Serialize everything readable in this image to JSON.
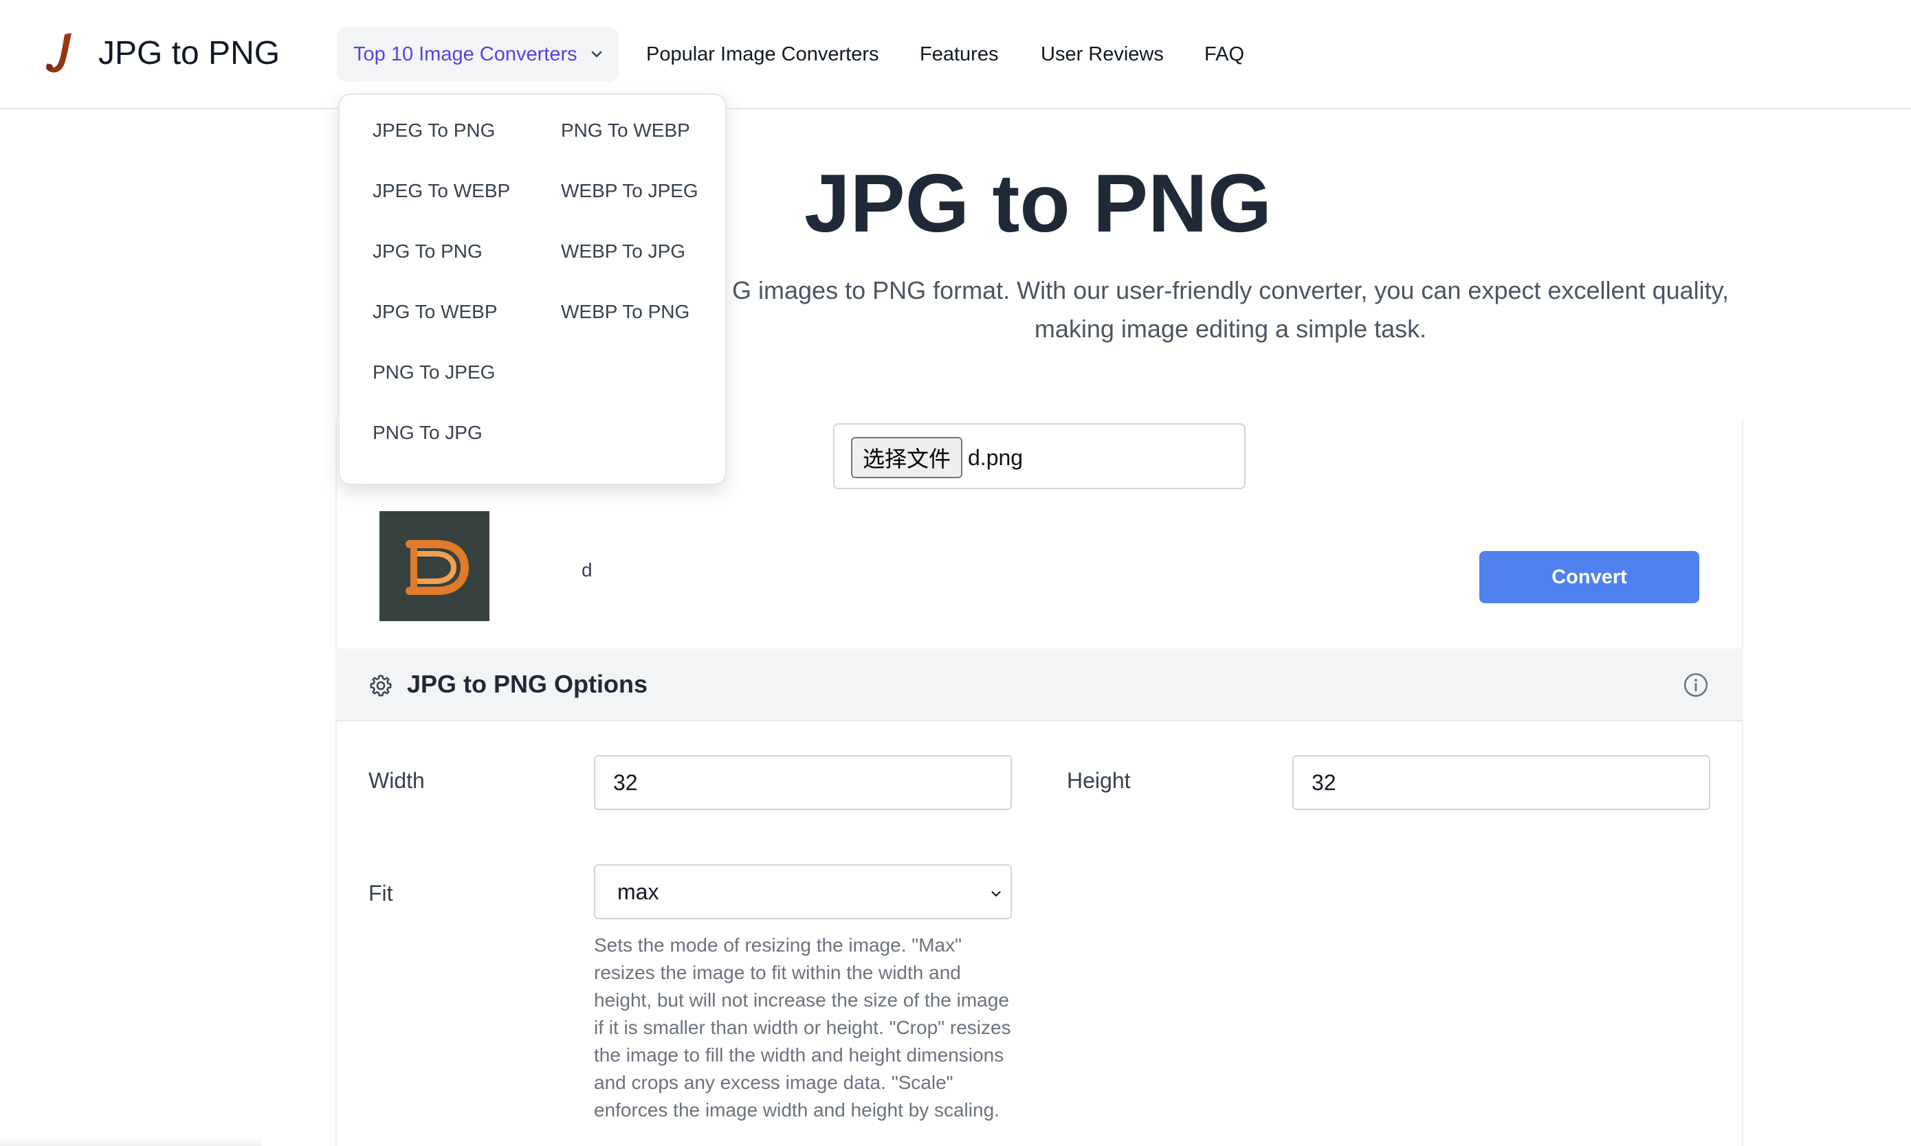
{
  "header": {
    "brand": "JPG to PNG",
    "logo_icon": "j-letter-logo-icon",
    "nav": {
      "dropdown_label": "Top 10 Image Converters",
      "items": [
        "Popular Image Converters",
        "Features",
        "User Reviews",
        "FAQ"
      ]
    }
  },
  "menu": {
    "col1": [
      "JPEG To PNG",
      "JPEG To WEBP",
      "JPG To PNG",
      "JPG To WEBP",
      "PNG To JPEG",
      "PNG To JPG"
    ],
    "col2": [
      "PNG To WEBP",
      "WEBP To JPEG",
      "WEBP To JPG",
      "WEBP To PNG"
    ]
  },
  "hero": {
    "title": "JPG to PNG",
    "subtitle_line1": "G images to PNG format. With our user-friendly converter, you can expect excellent quality,",
    "subtitle_line2": "making image editing a simple task."
  },
  "upload": {
    "choose_file_label": "选择文件",
    "file_name": "d.png",
    "thumbnail_name": "d",
    "convert_label": "Convert"
  },
  "options": {
    "title": "JPG to PNG Options",
    "width_label": "Width",
    "width_value": "32",
    "height_label": "Height",
    "height_value": "32",
    "fit_label": "Fit",
    "fit_value": "max",
    "fit_help": "Sets the mode of resizing the image. \"Max\" resizes the image to fit within the width and height, but will not increase the size of the image if it is smaller than width or height. \"Crop\" resizes the image to fill the width and height dimensions and crops any excess image data. \"Scale\" enforces the image width and height by scaling."
  },
  "colors": {
    "accent": "#4f46e5",
    "button": "#4f82ee",
    "thumb_bg": "#364140",
    "thumb_letter": "#e07b2a"
  }
}
